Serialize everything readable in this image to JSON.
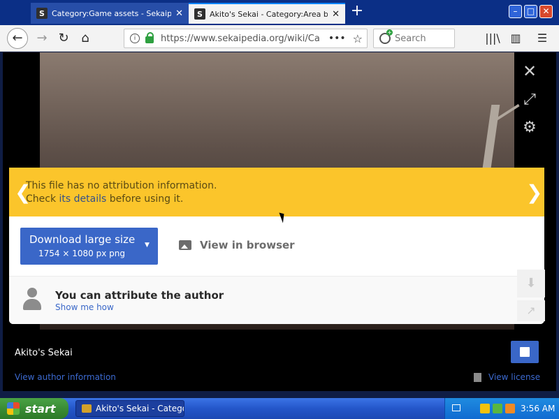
{
  "browser": {
    "tabs": [
      {
        "favicon": "S",
        "title": "Category:Game assets - Sekaipedia"
      },
      {
        "favicon": "S",
        "title": "Akito's Sekai - Category:Area back..."
      }
    ],
    "url": "https://www.sekaipedia.org/wiki/Ca",
    "search_placeholder": "Search"
  },
  "lightbox": {
    "warning_line1": "This file has no attribution information.",
    "warning_line2_pre": "Check ",
    "warning_line2_link": "its details",
    "warning_line2_post": " before using it.",
    "download_label": "Download large size",
    "download_sub": "1754 × 1080 px png",
    "view_in_browser": "View in browser",
    "attribute_title": "You can attribute the author",
    "attribute_link": "Show me how",
    "author": "Akito's Sekai",
    "view_author_info": "View author information",
    "view_license": "View license"
  },
  "taskbar": {
    "start": "start",
    "window_item": "Akito's Sekai - Catego...",
    "clock": "3:56 AM"
  },
  "colors": {
    "warning_bg": "#fbc52b",
    "primary_blue": "#3a67c8",
    "taskbar_blue": "#2456c9"
  }
}
